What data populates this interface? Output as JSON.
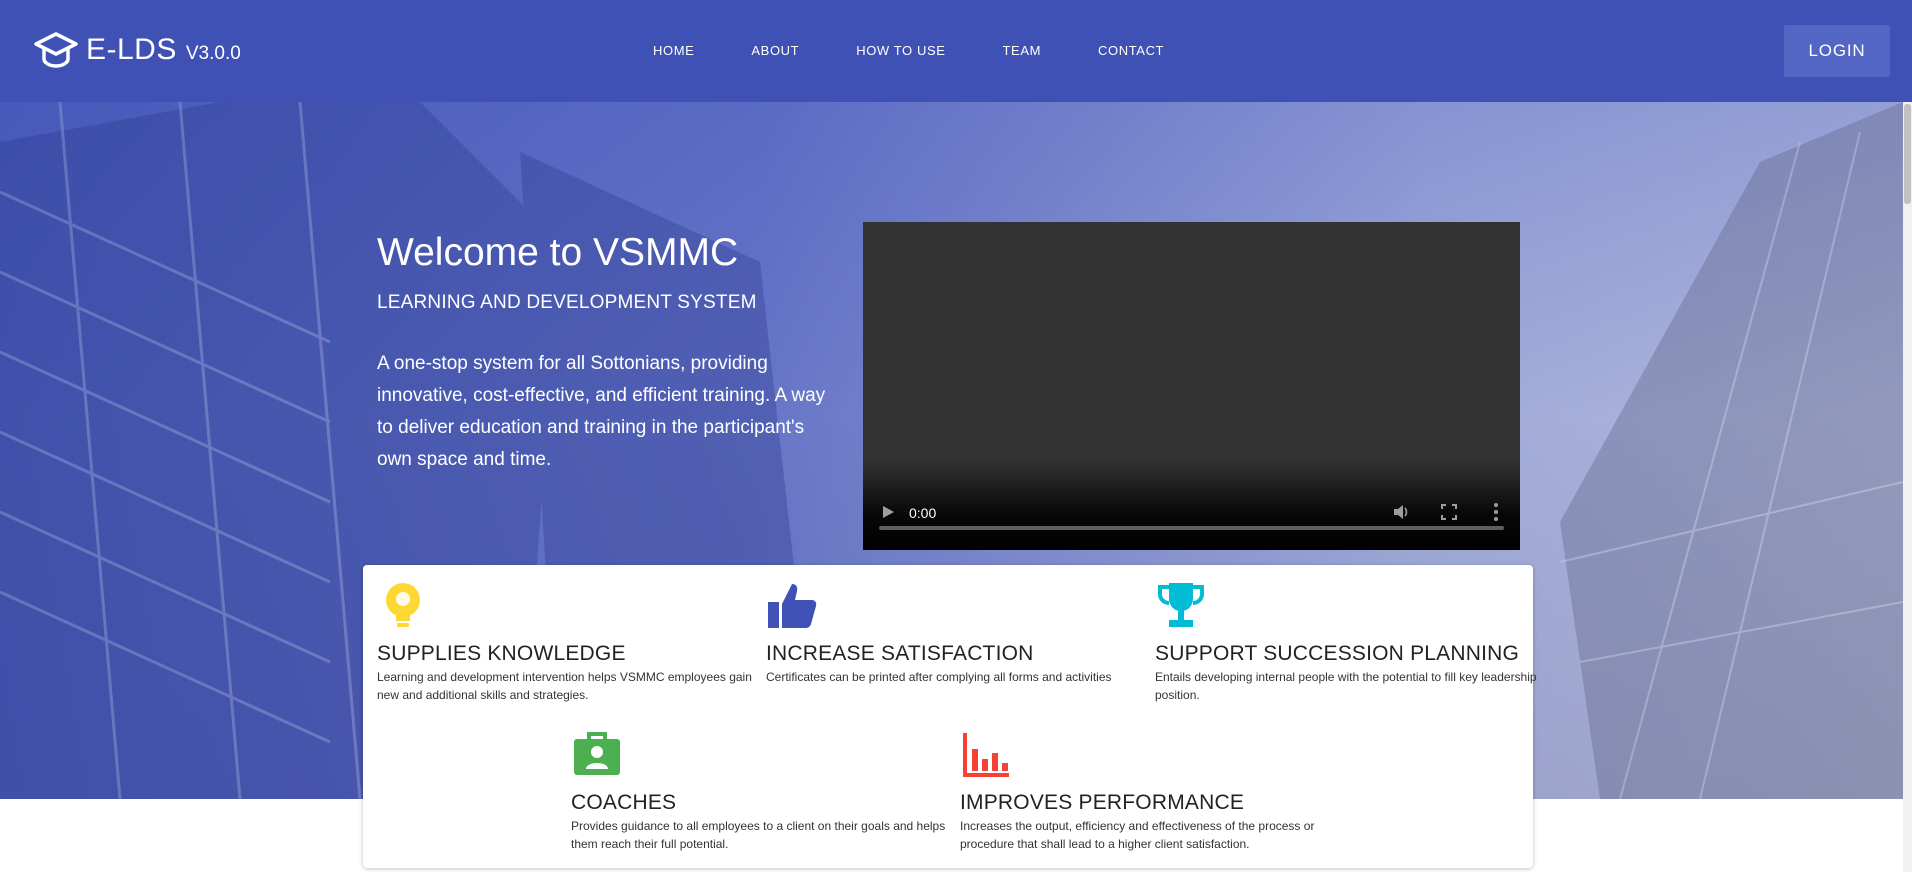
{
  "brand": {
    "name": "E-LDS",
    "version": "V3.0.0"
  },
  "nav": {
    "items": [
      "HOME",
      "ABOUT",
      "HOW TO USE",
      "TEAM",
      "CONTACT"
    ]
  },
  "login": {
    "label": "LOGIN"
  },
  "hero": {
    "title": "Welcome to VSMMC",
    "subtitle": "LEARNING AND DEVELOPMENT SYSTEM",
    "description": "A one-stop system for all Sottonians, providing innovative, cost-effective, and efficient training. A way to deliver education and training in the participant's own space and time."
  },
  "video": {
    "time": "0:00",
    "progress": 0
  },
  "features": [
    {
      "title": "SUPPLIES KNOWLEDGE",
      "description": "Learning and development intervention helps VSMMC employees gain new and additional skills and strategies.",
      "icon": "lightbulb-icon",
      "color": "#fdd835"
    },
    {
      "title": "INCREASE SATISFACTION",
      "description": "Certificates can be printed after complying all forms and activities",
      "icon": "thumbs-up-icon",
      "color": "#3f51b5"
    },
    {
      "title": "SUPPORT SUCCESSION PLANNING",
      "description": "Entails developing internal people with the potential to fill key leadership position.",
      "icon": "trophy-icon",
      "color": "#00bcd4"
    },
    {
      "title": "COACHES",
      "description": "Provides guidance to all employees to a client on their goals and helps them reach their full potential.",
      "icon": "briefcase-icon",
      "color": "#4caf50"
    },
    {
      "title": "IMPROVES PERFORMANCE",
      "description": "Increases the output, efficiency and effectiveness of the process or procedure that shall lead to a higher client satisfaction.",
      "icon": "bar-chart-icon",
      "color": "#f44336"
    }
  ],
  "colors": {
    "primary": "#3f51b5",
    "login_bg": "#5466c4"
  }
}
